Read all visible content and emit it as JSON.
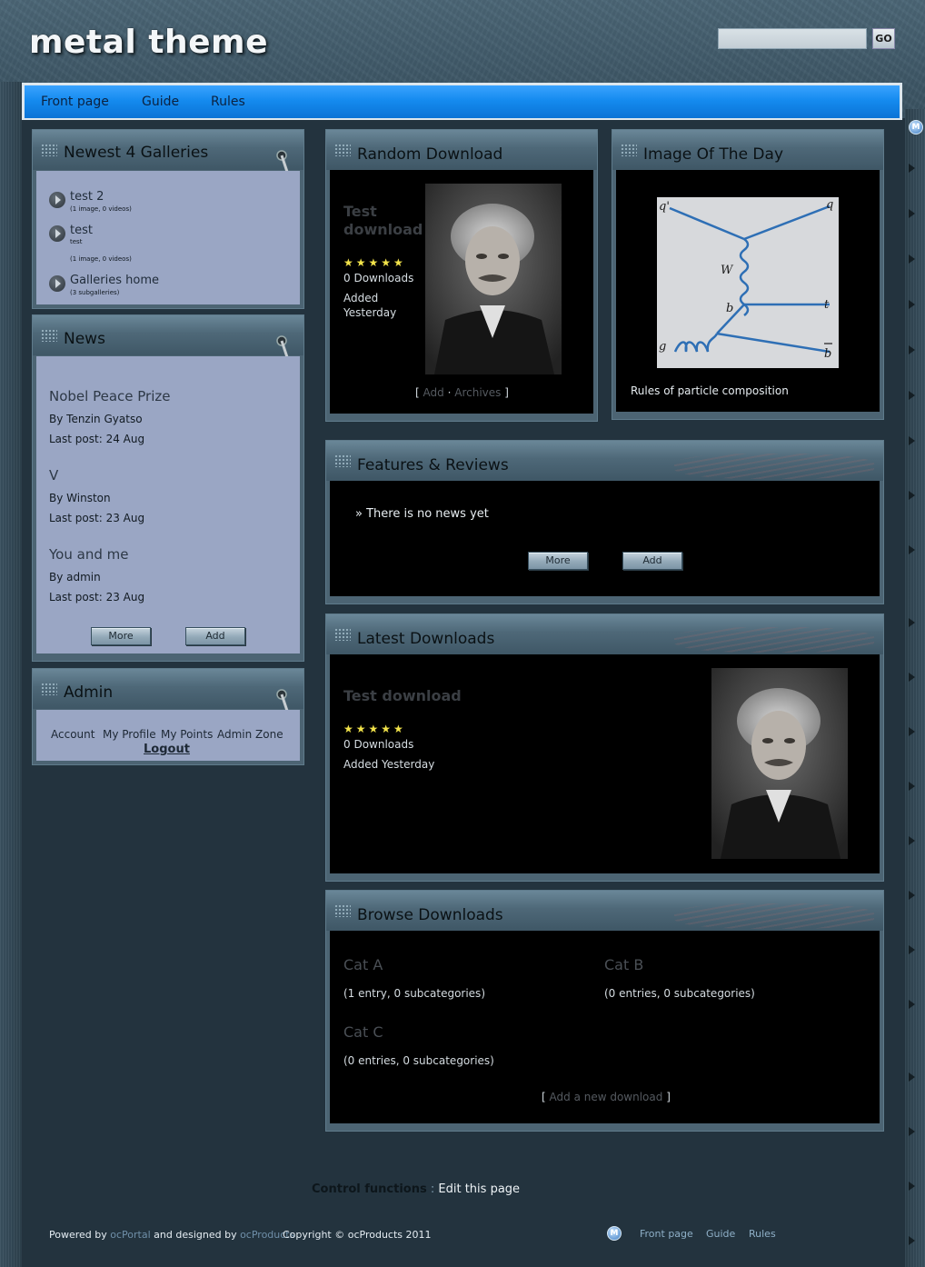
{
  "site": {
    "logo_text": "metal theme",
    "search_placeholder": "",
    "search_button": "GO"
  },
  "nav": {
    "items": [
      "Front page",
      "Guide",
      "Rules"
    ]
  },
  "galleries_panel": {
    "title": "Newest 4 Galleries",
    "items": [
      {
        "name": "test 2",
        "desc": "",
        "meta": "(1 image, 0 videos)"
      },
      {
        "name": "test",
        "desc": "test",
        "meta": "(1 image, 0 videos)"
      },
      {
        "name": "Galleries home",
        "desc": "",
        "meta": "(3 subgalleries)"
      }
    ]
  },
  "news_panel": {
    "title": "News",
    "items": [
      {
        "title": "Nobel Peace Prize",
        "by": "By Tenzin Gyatso",
        "last": "Last post: 24 Aug"
      },
      {
        "title": "V",
        "by": "By Winston",
        "last": "Last post: 23 Aug"
      },
      {
        "title": "You and me",
        "by": "By admin",
        "last": "Last post: 23 Aug"
      }
    ],
    "more_label": "More",
    "add_label": "Add"
  },
  "admin_panel": {
    "title": "Admin",
    "links": [
      "Account",
      "My Profile",
      "My Points",
      "Admin Zone"
    ],
    "logout": "Logout"
  },
  "random_download": {
    "title": "Random Download",
    "item_title_line1": "Test",
    "item_title_line2": "download",
    "stars": "★★★★★",
    "downloads": "0 Downloads",
    "added_line1": "Added",
    "added_line2": "Yesterday",
    "bracket_open": "[",
    "add_link": "Add",
    "separator": "·",
    "archives_link": "Archives",
    "bracket_close": "]"
  },
  "image_of_day": {
    "title": "Image Of The Day",
    "caption": "Rules of particle composition",
    "diagram_labels": {
      "q_prime": "q'",
      "q": "q",
      "w": "W",
      "b_mid": "b",
      "t": "t",
      "g": "g",
      "b_bar": "b"
    }
  },
  "features_panel": {
    "title": "Features & Reviews",
    "empty_text": "» There is no news yet",
    "more_label": "More",
    "add_label": "Add"
  },
  "latest_downloads": {
    "title": "Latest Downloads",
    "item_title": "Test download",
    "stars": "★★★★★",
    "downloads": "0 Downloads",
    "added": "Added Yesterday"
  },
  "browse_downloads": {
    "title": "Browse Downloads",
    "categories": [
      {
        "name": "Cat A",
        "info": "(1 entry, 0 subcategories)"
      },
      {
        "name": "Cat B",
        "info": "(0 entries, 0 subcategories)"
      },
      {
        "name": "Cat C",
        "info": "(0 entries, 0 subcategories)"
      }
    ],
    "bracket_open": "[",
    "add_new_label": "Add a new download",
    "bracket_close": "]"
  },
  "control_functions": {
    "label": "Control functions",
    "separator": ":",
    "edit_link": "Edit this page"
  },
  "footer": {
    "powered_by": "Powered by",
    "ocportal": "ocPortal",
    "designed_by": "and designed by",
    "ocproducts": "ocProducts",
    "copyright": "Copyright © ocProducts 2011",
    "nav": [
      "Front page",
      "Guide",
      "Rules"
    ]
  },
  "colors": {
    "nav_blue": "#158bef",
    "panel_light": "#9aa6c4",
    "panel_dark": "#000000",
    "star_yellow": "#f2e34a"
  }
}
